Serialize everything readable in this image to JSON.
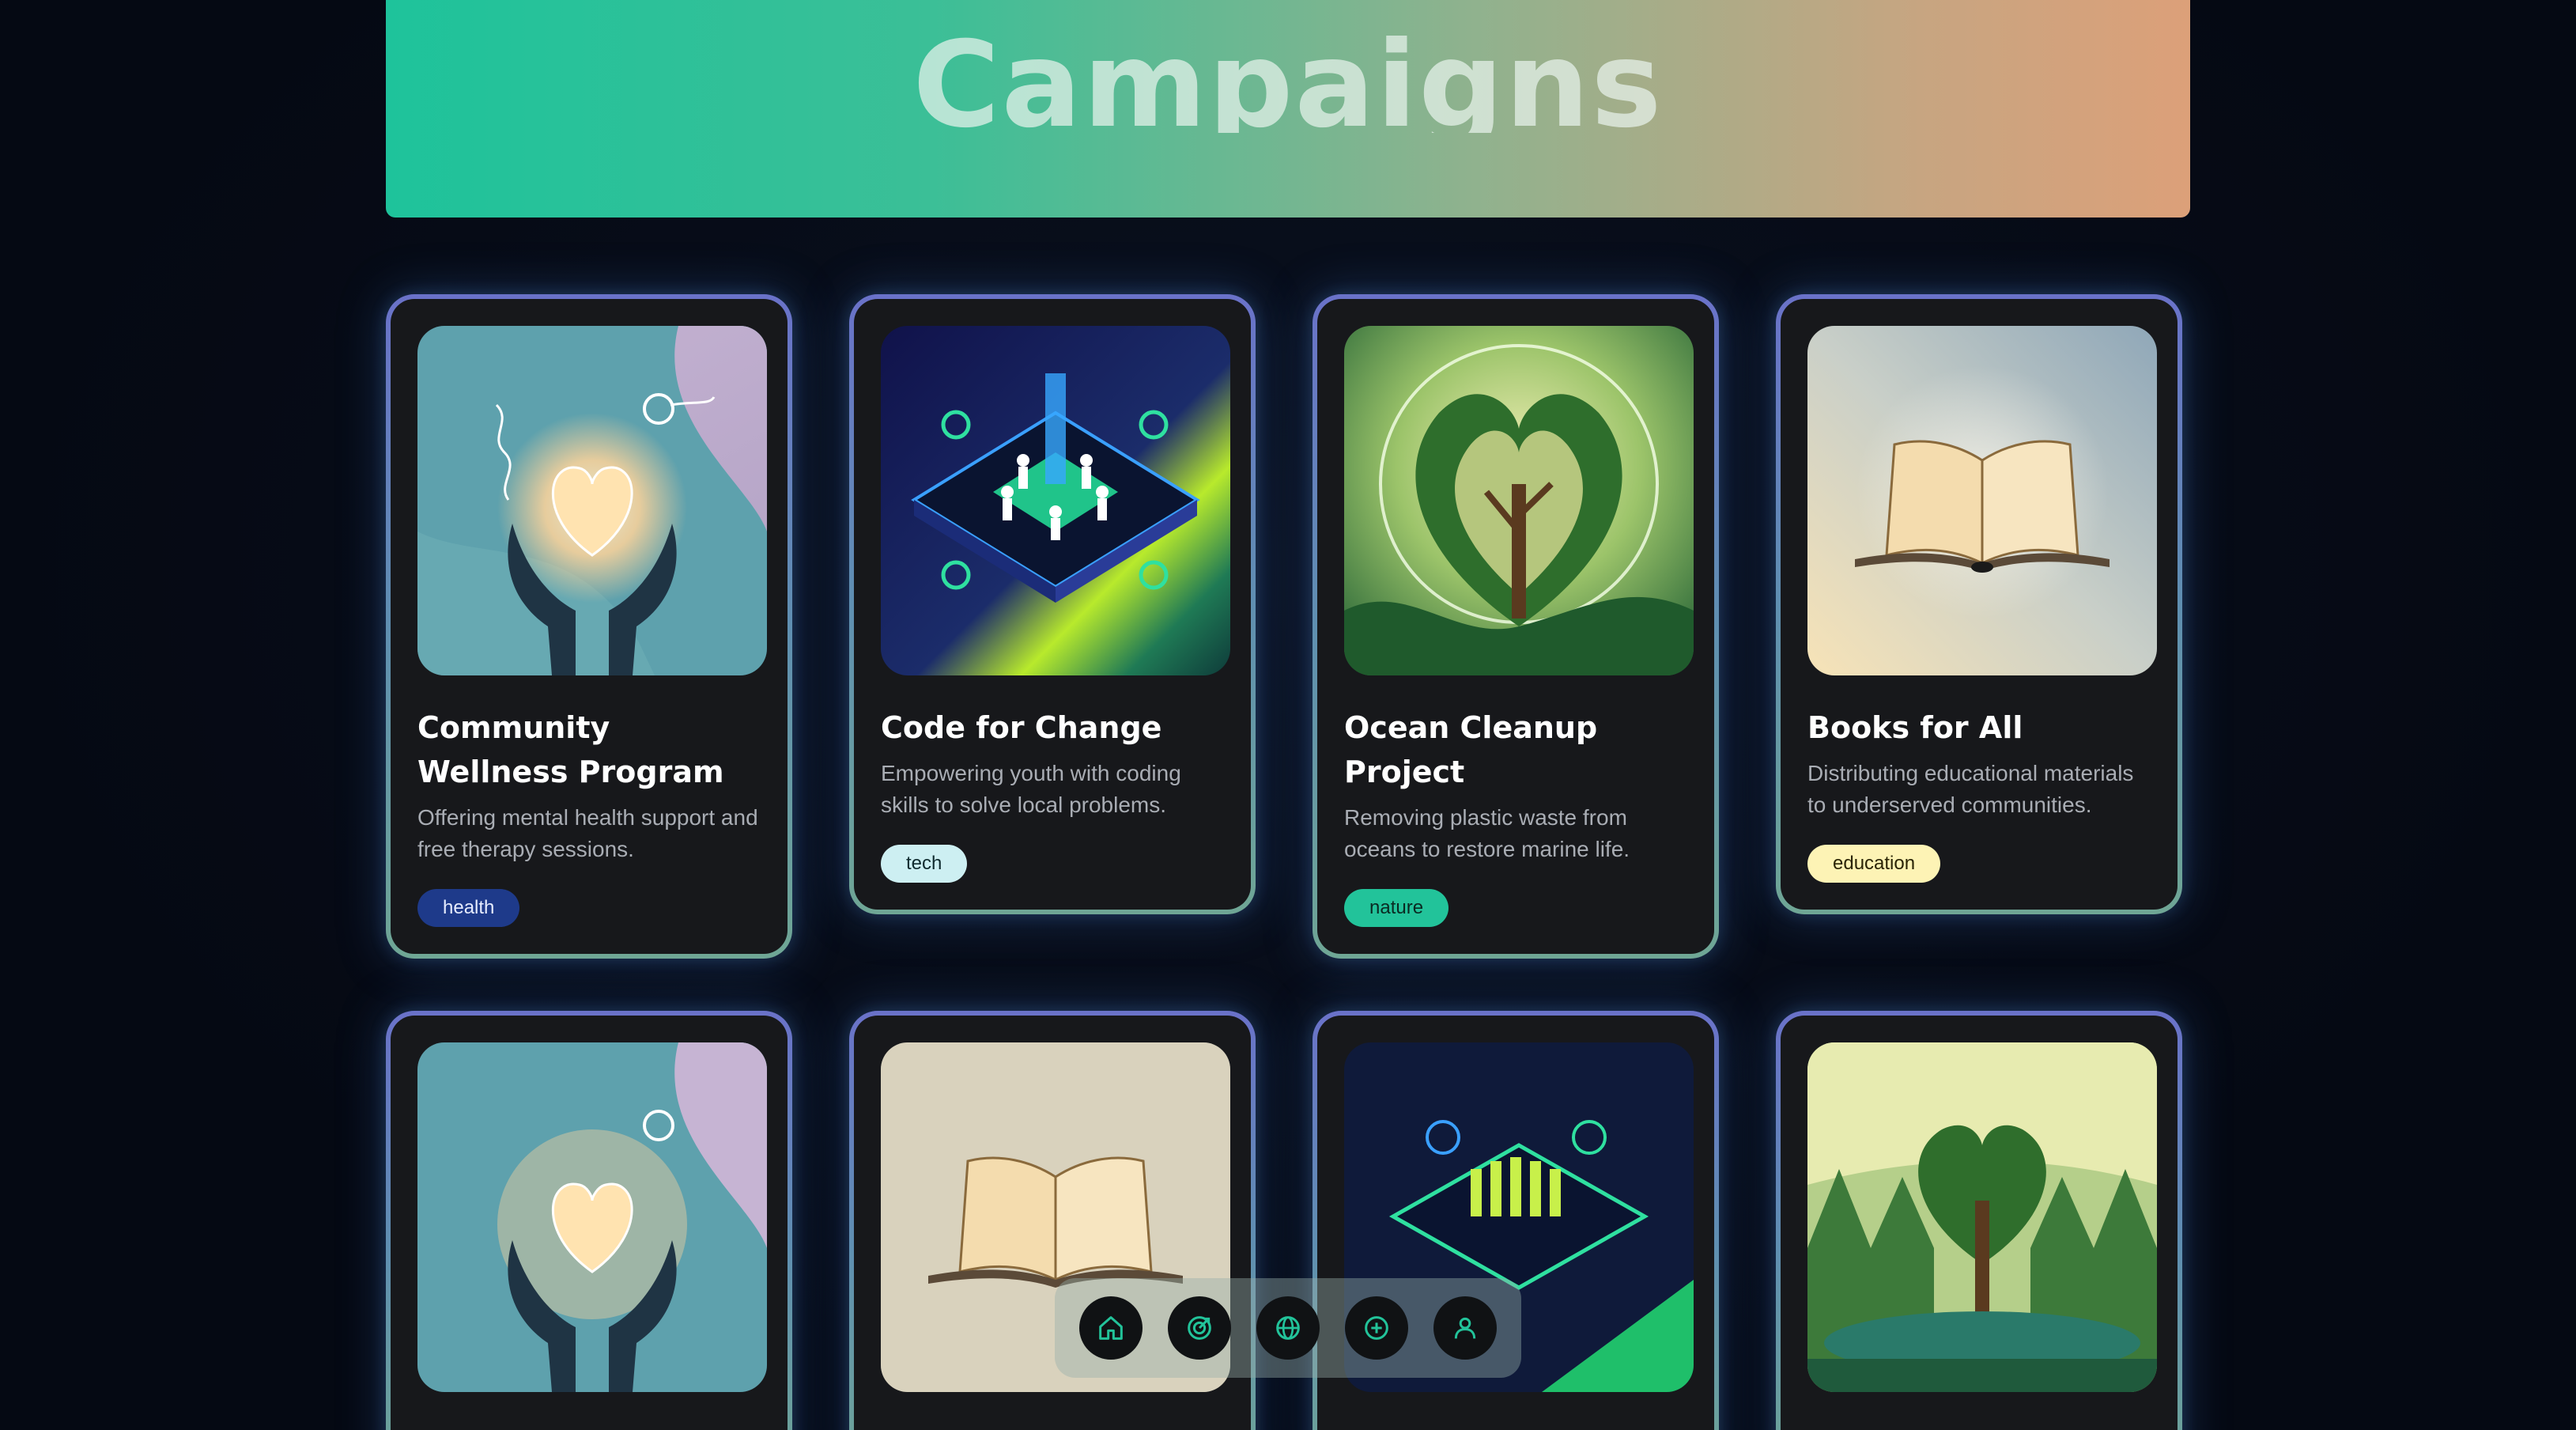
{
  "header": {
    "title": "Campaigns"
  },
  "campaigns_row1": [
    {
      "title": "Community Wellness Program",
      "description": "Offering mental health support and free therapy sessions.",
      "tag": "health",
      "image_icon": "heart-in-hands-illustration"
    },
    {
      "title": "Code for Change",
      "description": "Empowering youth with coding skills to solve local problems.",
      "tag": "tech",
      "image_icon": "circuit-community-illustration"
    },
    {
      "title": "Ocean Cleanup Project",
      "description": "Removing plastic waste from oceans to restore marine life.",
      "tag": "nature",
      "image_icon": "heart-tree-illustration"
    },
    {
      "title": "Books for All",
      "description": "Distributing educational materials to underserved communities.",
      "tag": "education",
      "image_icon": "open-book-illustration"
    }
  ],
  "campaigns_row2": [
    {
      "image_icon": "heart-in-hands-illustration"
    },
    {
      "image_icon": "open-book-illustration"
    },
    {
      "image_icon": "circuit-community-illustration"
    },
    {
      "image_icon": "heart-tree-illustration"
    }
  ],
  "nav": {
    "items": [
      {
        "icon": "home-icon"
      },
      {
        "icon": "target-icon"
      },
      {
        "icon": "globe-icon"
      },
      {
        "icon": "plus-circle-icon"
      },
      {
        "icon": "user-icon"
      }
    ]
  },
  "colors": {
    "background": "#060b16",
    "card": "#17181b",
    "accent": "#22c39a",
    "tag_health": "#1e3a8a",
    "tag_tech": "#cdeff2",
    "tag_nature": "#22c39a",
    "tag_education": "#fdf3b5"
  }
}
